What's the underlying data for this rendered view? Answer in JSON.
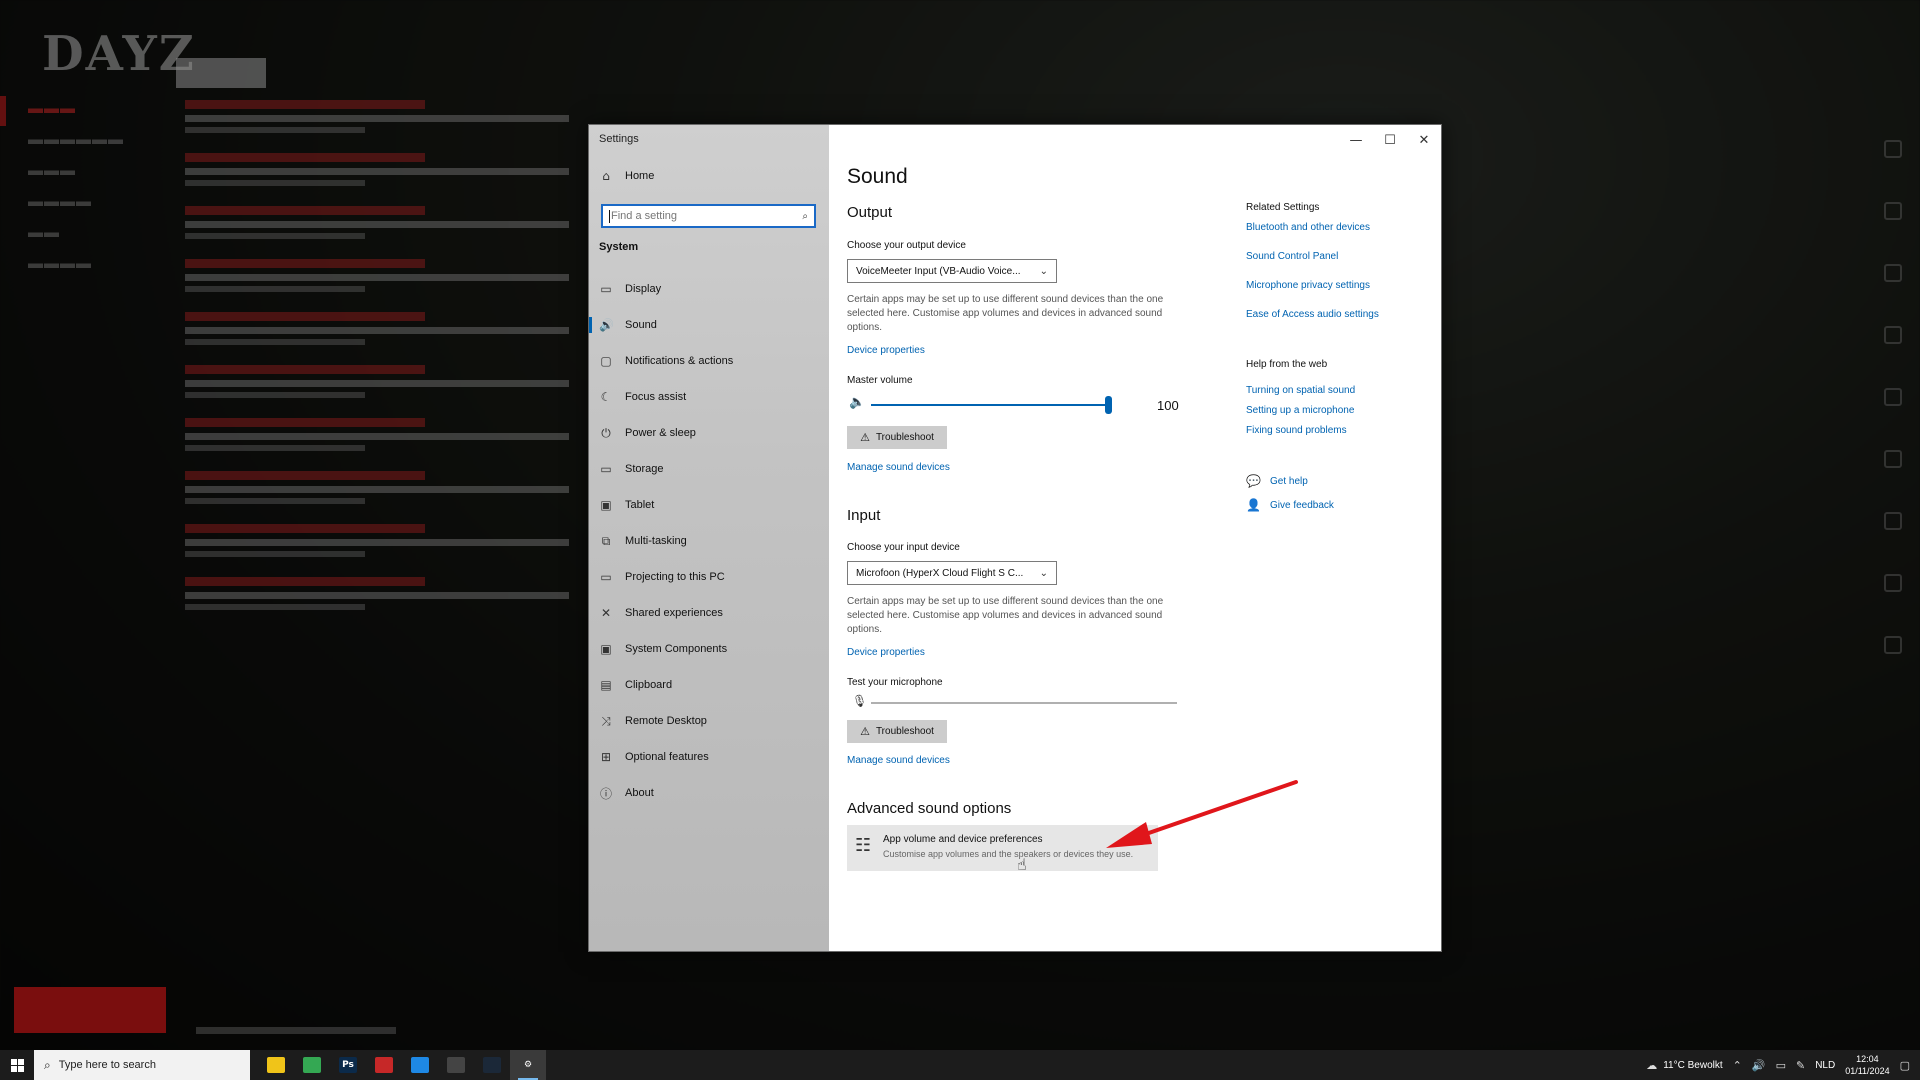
{
  "window": {
    "title": "Settings",
    "controls": {
      "minimize": "—",
      "maximize": "☐",
      "close": "✕"
    }
  },
  "sidebar": {
    "home_label": "Home",
    "search_placeholder": "Find a setting",
    "section_label": "System",
    "items": [
      {
        "label": "Display",
        "icon": "monitor-icon",
        "glyph": "▭"
      },
      {
        "label": "Sound",
        "icon": "speaker-icon",
        "glyph": "🔊",
        "active": true
      },
      {
        "label": "Notifications & actions",
        "icon": "notification-icon",
        "glyph": "▢"
      },
      {
        "label": "Focus assist",
        "icon": "moon-icon",
        "glyph": "☾"
      },
      {
        "label": "Power & sleep",
        "icon": "power-icon",
        "glyph": "⏻"
      },
      {
        "label": "Storage",
        "icon": "storage-icon",
        "glyph": "▭"
      },
      {
        "label": "Tablet",
        "icon": "tablet-icon",
        "glyph": "▣"
      },
      {
        "label": "Multi-tasking",
        "icon": "multitask-icon",
        "glyph": "⧉"
      },
      {
        "label": "Projecting to this PC",
        "icon": "project-icon",
        "glyph": "▭"
      },
      {
        "label": "Shared experiences",
        "icon": "shared-icon",
        "glyph": "✕"
      },
      {
        "label": "System Components",
        "icon": "components-icon",
        "glyph": "▣"
      },
      {
        "label": "Clipboard",
        "icon": "clipboard-icon",
        "glyph": "▤"
      },
      {
        "label": "Remote Desktop",
        "icon": "remote-icon",
        "glyph": "⤨"
      },
      {
        "label": "Optional features",
        "icon": "features-icon",
        "glyph": "⊞"
      },
      {
        "label": "About",
        "icon": "info-icon",
        "glyph": "ⓘ"
      }
    ]
  },
  "main": {
    "title": "Sound",
    "output": {
      "heading": "Output",
      "device_label": "Choose your output device",
      "device_value": "VoiceMeeter Input (VB-Audio Voice...",
      "description": "Certain apps may be set up to use different sound devices than the one selected here. Customise app volumes and devices in advanced sound options.",
      "device_properties": "Device properties",
      "master_volume_label": "Master volume",
      "master_volume_value": "100",
      "volume_fraction": 1.0,
      "troubleshoot": "Troubleshoot",
      "manage_devices": "Manage sound devices"
    },
    "input": {
      "heading": "Input",
      "device_label": "Choose your input device",
      "device_value": "Microfoon (HyperX Cloud Flight S C...",
      "description": "Certain apps may be set up to use different sound devices than the one selected here. Customise app volumes and devices in advanced sound options.",
      "device_properties": "Device properties",
      "test_mic_label": "Test your microphone",
      "troubleshoot": "Troubleshoot",
      "manage_devices": "Manage sound devices"
    },
    "advanced": {
      "heading": "Advanced sound options",
      "card_title": "App volume and device preferences",
      "card_subtitle": "Customise app volumes and the speakers or devices they use."
    }
  },
  "related": {
    "heading": "Related Settings",
    "links": [
      "Bluetooth and other devices",
      "Sound Control Panel",
      "Microphone privacy settings",
      "Ease of Access audio settings"
    ],
    "help_heading": "Help from the web",
    "help_links": [
      "Turning on spatial sound",
      "Setting up a microphone",
      "Fixing sound problems"
    ],
    "get_help": "Get help",
    "give_feedback": "Give feedback"
  },
  "taskbar": {
    "search_placeholder": "Type here to search",
    "apps": [
      {
        "name": "file-explorer",
        "color": "#f0c419",
        "glyph": ""
      },
      {
        "name": "chrome",
        "color": "#34a853",
        "glyph": ""
      },
      {
        "name": "photoshop",
        "color": "#0b2a4a",
        "glyph": "Ps"
      },
      {
        "name": "app-red",
        "color": "#c62828",
        "glyph": ""
      },
      {
        "name": "app-blue",
        "color": "#1e88e5",
        "glyph": ""
      },
      {
        "name": "dayz",
        "color": "#444444",
        "glyph": ""
      },
      {
        "name": "steam",
        "color": "#1b2838",
        "glyph": ""
      },
      {
        "name": "settings",
        "color": "#3a3a3a",
        "glyph": "⚙",
        "active": true
      }
    ],
    "weather": "11°C  Bewolkt",
    "language": "NLD",
    "time": "12:04",
    "date": "01/11/2024"
  },
  "colors": {
    "accent": "#0063b1",
    "annotation_arrow": "#e0161b"
  }
}
